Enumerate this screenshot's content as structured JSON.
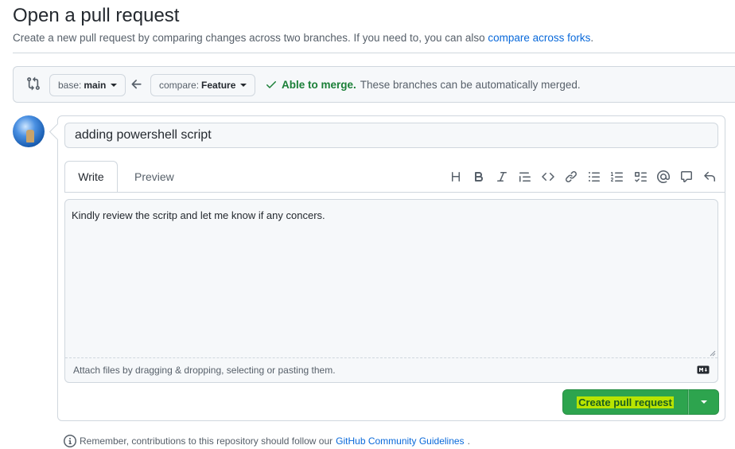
{
  "header": {
    "title": "Open a pull request",
    "subtitle_prefix": "Create a new pull request by comparing changes across two branches. If you need to, you can also ",
    "subtitle_link": "compare across forks",
    "subtitle_suffix": "."
  },
  "range": {
    "base_label": "base:",
    "base_branch": "main",
    "compare_label": "compare:",
    "compare_branch": "Feature",
    "merge_status": "Able to merge.",
    "merge_detail": "These branches can be automatically merged."
  },
  "composer": {
    "title_value": "adding powershell script",
    "tabs": [
      "Write",
      "Preview"
    ],
    "toolbar_icons": [
      "heading-icon",
      "bold-icon",
      "italic-icon",
      "quote-icon",
      "code-icon",
      "link-icon",
      "unordered-list-icon",
      "ordered-list-icon",
      "task-list-icon",
      "mention-icon",
      "reference-icon",
      "reply-icon"
    ],
    "body_value": "Kindly review the scritp and let me know if any concers.",
    "attach_hint": "Attach files by dragging & dropping, selecting or pasting them.",
    "create_label": "Create pull request"
  },
  "footer": {
    "note_prefix": "Remember, contributions to this repository should follow our ",
    "note_link": "GitHub Community Guidelines",
    "note_suffix": "."
  },
  "colors": {
    "accent_link": "#0969da",
    "success": "#1a7f37",
    "primary_button": "#2da44e",
    "highlight": "#b9e400"
  }
}
